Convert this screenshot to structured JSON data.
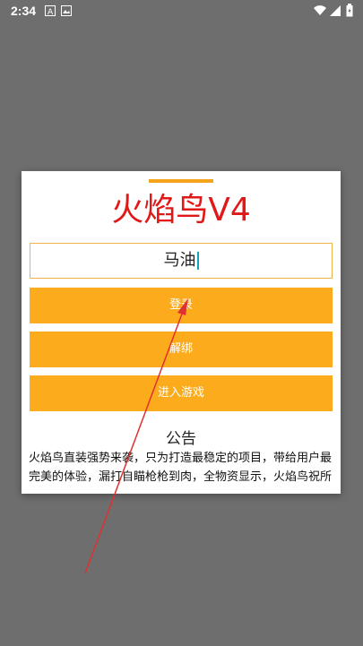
{
  "status_bar": {
    "time": "2:34",
    "left_icons": [
      "a-icon",
      "image-icon"
    ],
    "right_icons": [
      "wifi-icon",
      "signal-icon",
      "battery-icon"
    ]
  },
  "dialog": {
    "title": "火焰鸟V4",
    "input": {
      "value": "马油"
    },
    "buttons": {
      "login": "登录",
      "unbind": "解绑",
      "enter_game": "进入游戏"
    },
    "notice": {
      "title": "公告",
      "text": "火焰鸟直装强势来袭，只为打造最稳定的项目，带给用户最完美的体验，漏打自瞄枪枪到肉，全物资显示，火焰鸟祝所"
    }
  },
  "colors": {
    "accent": "#fcab1d",
    "title": "#e01818",
    "overlay": "#6e6e6e",
    "arrow": "#e03030"
  }
}
